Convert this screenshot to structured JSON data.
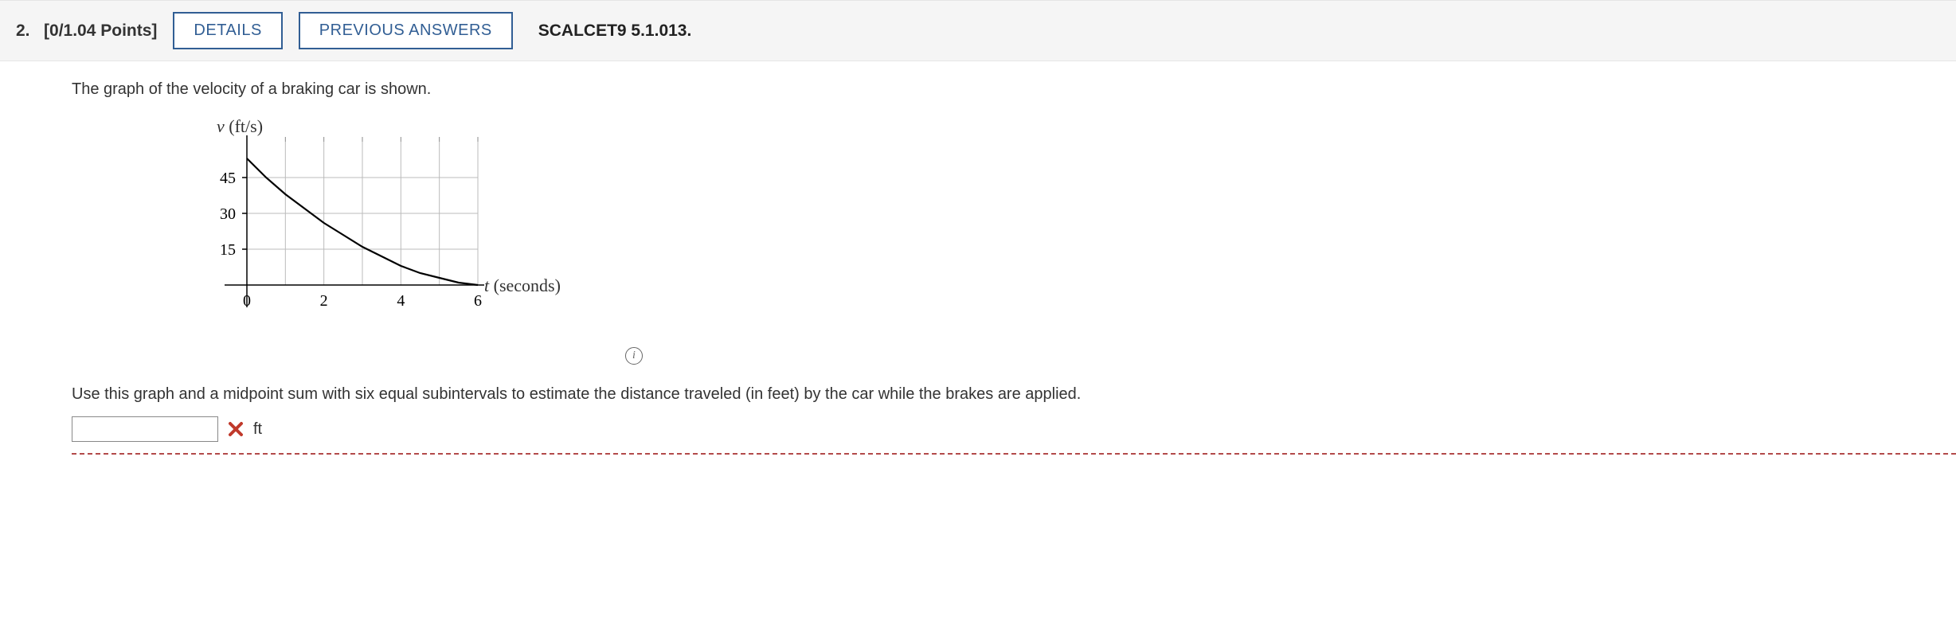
{
  "header": {
    "number": "2.",
    "points": "[0/1.04 Points]",
    "details_label": "DETAILS",
    "prev_label": "PREVIOUS ANSWERS",
    "book_ref": "SCALCET9 5.1.013."
  },
  "prompt": "The graph of the velocity of a braking car is shown.",
  "question": "Use this graph and a midpoint sum with six equal subintervals to estimate the distance traveled (in feet) by the car while the brakes are applied.",
  "answer": {
    "value": "",
    "unit": "ft",
    "wrong": true
  },
  "chart_data": {
    "type": "line",
    "title": "",
    "xlabel": "t  (seconds)",
    "ylabel": "v  (ft/s)",
    "xlim": [
      0,
      6
    ],
    "ylim": [
      0,
      60
    ],
    "x_ticks": [
      0,
      2,
      4,
      6
    ],
    "y_ticks": [
      15,
      30,
      45
    ],
    "x": [
      0,
      0.5,
      1,
      1.5,
      2,
      2.5,
      3,
      3.5,
      4,
      4.5,
      5,
      5.5,
      6
    ],
    "values": [
      53,
      45,
      38,
      32,
      26,
      21,
      16,
      12,
      8,
      5,
      3,
      1,
      0
    ],
    "series_name": "velocity"
  }
}
